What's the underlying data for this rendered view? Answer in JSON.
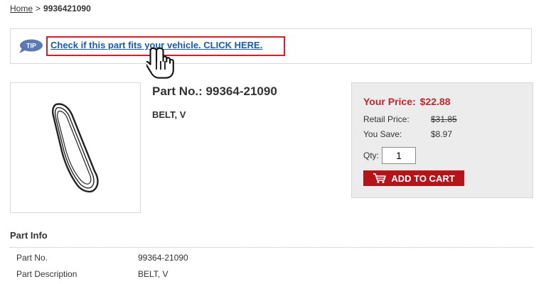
{
  "breadcrumb": {
    "home": "Home",
    "separator": ">",
    "current": "9936421090"
  },
  "tip": {
    "badge": "TIP",
    "link_text": "Check if this part fits your vehicle. CLICK HERE",
    "trailing": ".",
    "badge_color": "#5b79b5",
    "highlight_color": "#d21f28"
  },
  "product": {
    "image_icon": "v-belt-drawing-icon",
    "title": "Part No.: 99364-21090",
    "description": "BELT, V"
  },
  "pricing": {
    "your_price_label": "Your Price:",
    "your_price": "$22.88",
    "retail_label": "Retail Price:",
    "retail_price": "$31.85",
    "save_label": "You Save:",
    "save_amount": "$8.97",
    "qty_label": "Qty:",
    "qty_value": "1",
    "add_to_cart": "ADD TO CART",
    "price_color": "#c1272d",
    "button_color": "#b5141b"
  },
  "part_info": {
    "heading": "Part Info",
    "rows": [
      {
        "label": "Part No.",
        "value": "99364-21090"
      },
      {
        "label": "Part Description",
        "value": "BELT, V"
      }
    ]
  }
}
